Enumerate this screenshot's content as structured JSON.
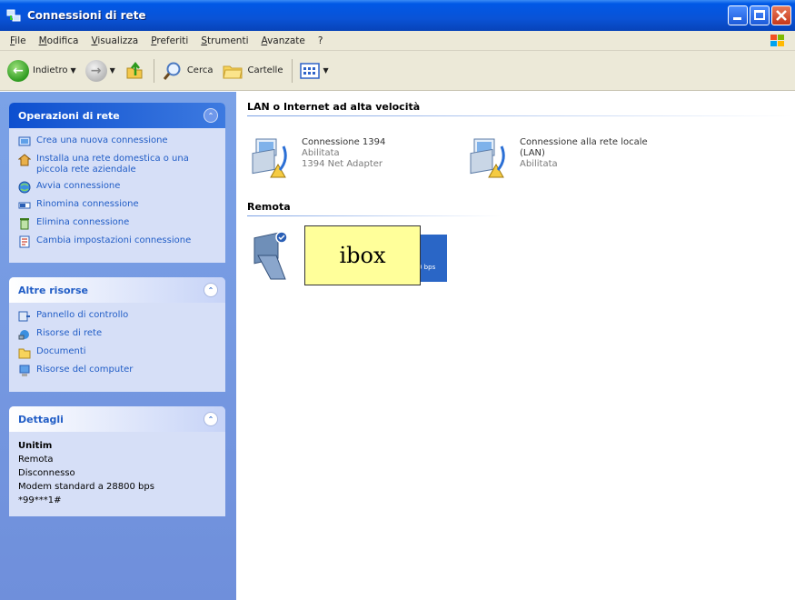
{
  "window": {
    "title": "Connessioni di rete"
  },
  "menu": [
    "File",
    "Modifica",
    "Visualizza",
    "Preferiti",
    "Strumenti",
    "Avanzate",
    "?"
  ],
  "toolbar": {
    "back": "Indietro",
    "search": "Cerca",
    "folders": "Cartelle"
  },
  "sidebar": {
    "network_tasks": {
      "title": "Operazioni di rete",
      "items": [
        "Crea una nuova connessione",
        "Installa una rete domestica o una piccola rete aziendale",
        "Avvia connessione",
        "Rinomina connessione",
        "Elimina connessione",
        "Cambia impostazioni connessione"
      ]
    },
    "other_places": {
      "title": "Altre risorse",
      "items": [
        "Pannello di controllo",
        "Risorse di rete",
        "Documenti",
        "Risorse del computer"
      ]
    },
    "details": {
      "title": "Dettagli",
      "name": "Unitim",
      "lines": [
        "Remota",
        "Disconnesso",
        "Modem standard a 28800 bps",
        "*99***1#"
      ]
    }
  },
  "content": {
    "group_lan": "LAN o Internet ad alta velocità",
    "conn1": {
      "name": "Connessione 1394",
      "status": "Abilitata",
      "device": "1394 Net Adapter"
    },
    "conn2": {
      "name": "Connessione alla rete locale",
      "name2": "(LAN)",
      "status": "Abilitata"
    },
    "group_remote": "Remota",
    "remote_partial": "0 bps",
    "overlay": "ibox"
  }
}
